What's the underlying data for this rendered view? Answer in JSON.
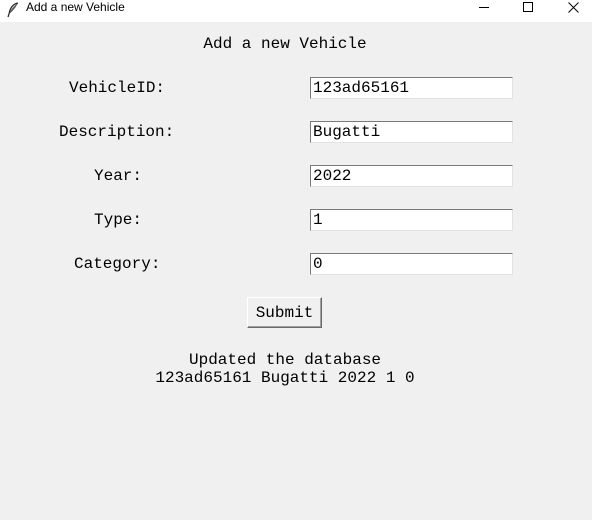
{
  "window": {
    "title": "Add a new Vehicle",
    "icon": "feather-icon",
    "controls": [
      "minimize-icon",
      "maximize-icon",
      "close-icon"
    ]
  },
  "form": {
    "heading": "Add a new Vehicle",
    "fields": [
      {
        "label": "VehicleID:",
        "value": "123ad65161"
      },
      {
        "label": "Description:",
        "value": "Bugatti"
      },
      {
        "label": "Year:",
        "value": "2022"
      },
      {
        "label": "Type:",
        "value": "1"
      },
      {
        "label": "Category:",
        "value": "0"
      }
    ],
    "submit_label": "Submit"
  },
  "status": {
    "line1": "Updated the database",
    "line2": "123ad65161 Bugatti 2022 1 0"
  }
}
